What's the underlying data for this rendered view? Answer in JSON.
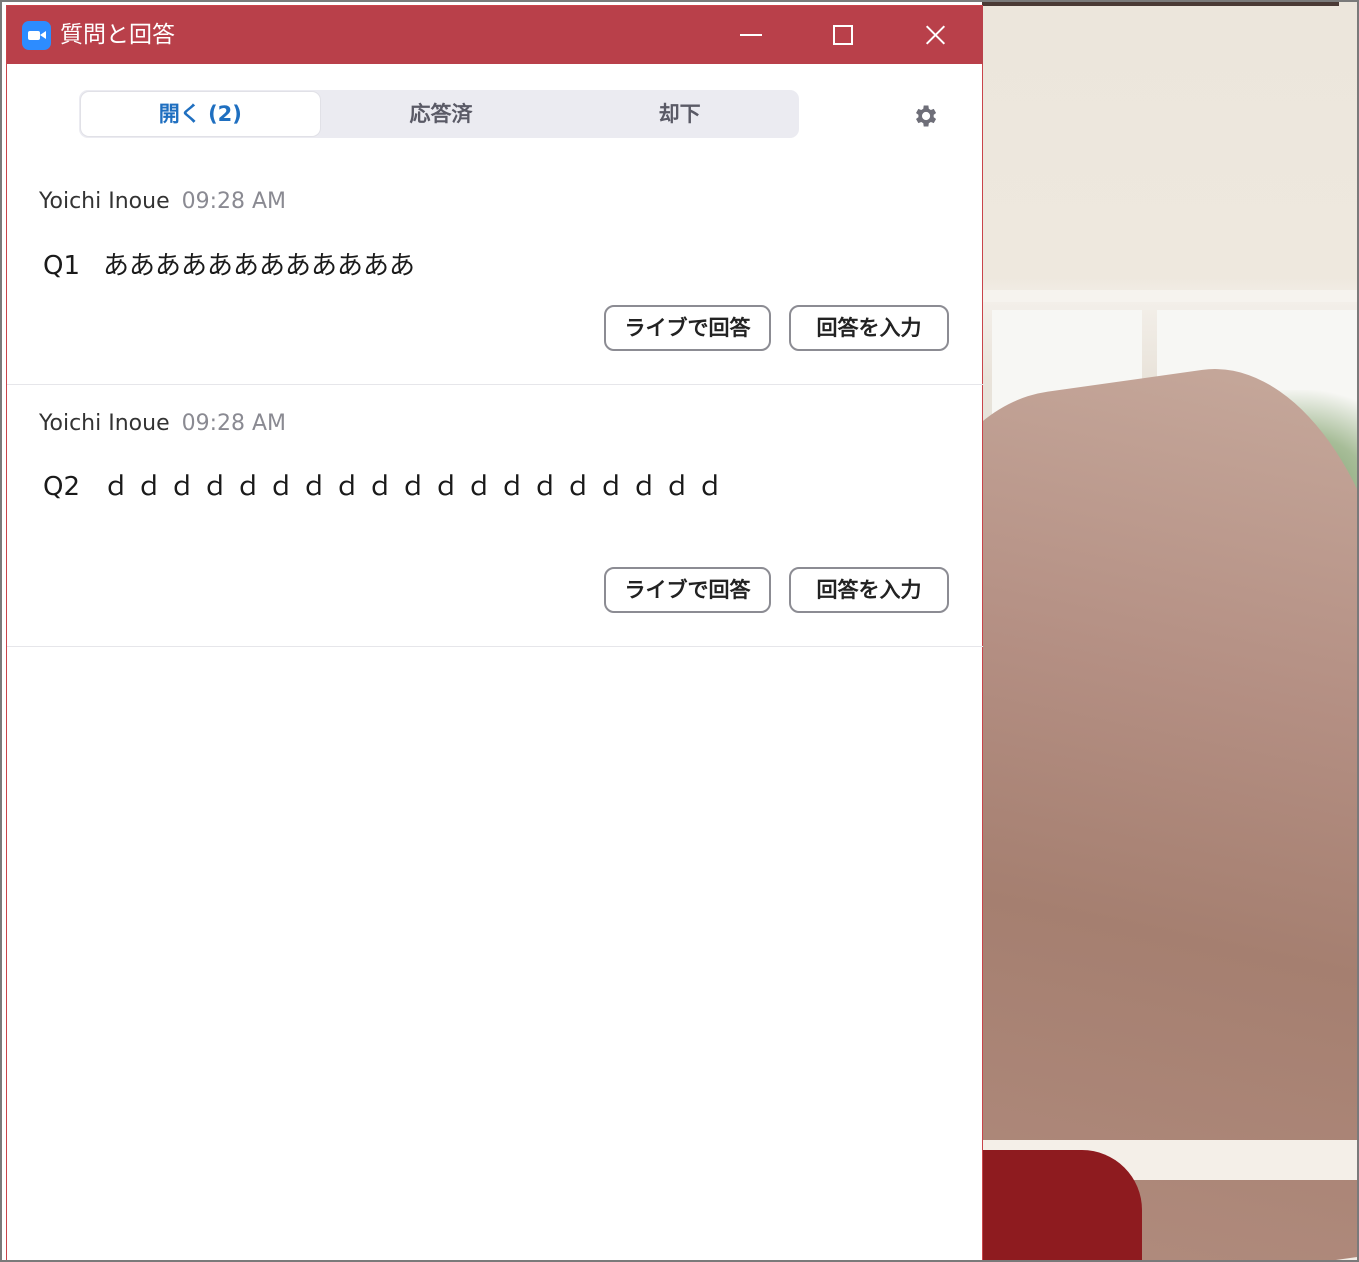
{
  "window": {
    "title": "質問と回答",
    "title_bar_color": "#b9404a",
    "controls": [
      "minimize-icon",
      "maximize-icon",
      "close-icon"
    ]
  },
  "tabs": [
    {
      "label": "開く (2)",
      "active": true
    },
    {
      "label": "応答済",
      "active": false
    },
    {
      "label": "却下",
      "active": false
    }
  ],
  "accent_color": "#1f6fc0",
  "questions": [
    {
      "author": "Yoichi Inoue",
      "time": "09:28 AM",
      "number": "Q1",
      "text": "ああああああああああああ",
      "answer_live_label": "ライブで回答",
      "type_answer_label": "回答を入力"
    },
    {
      "author": "Yoichi Inoue",
      "time": "09:28 AM",
      "number": "Q2",
      "text": "ｄｄｄｄｄｄｄｄｄｄｄｄｄｄｄｄｄｄｄ",
      "answer_live_label": "ライブで回答",
      "type_answer_label": "回答を入力"
    }
  ]
}
